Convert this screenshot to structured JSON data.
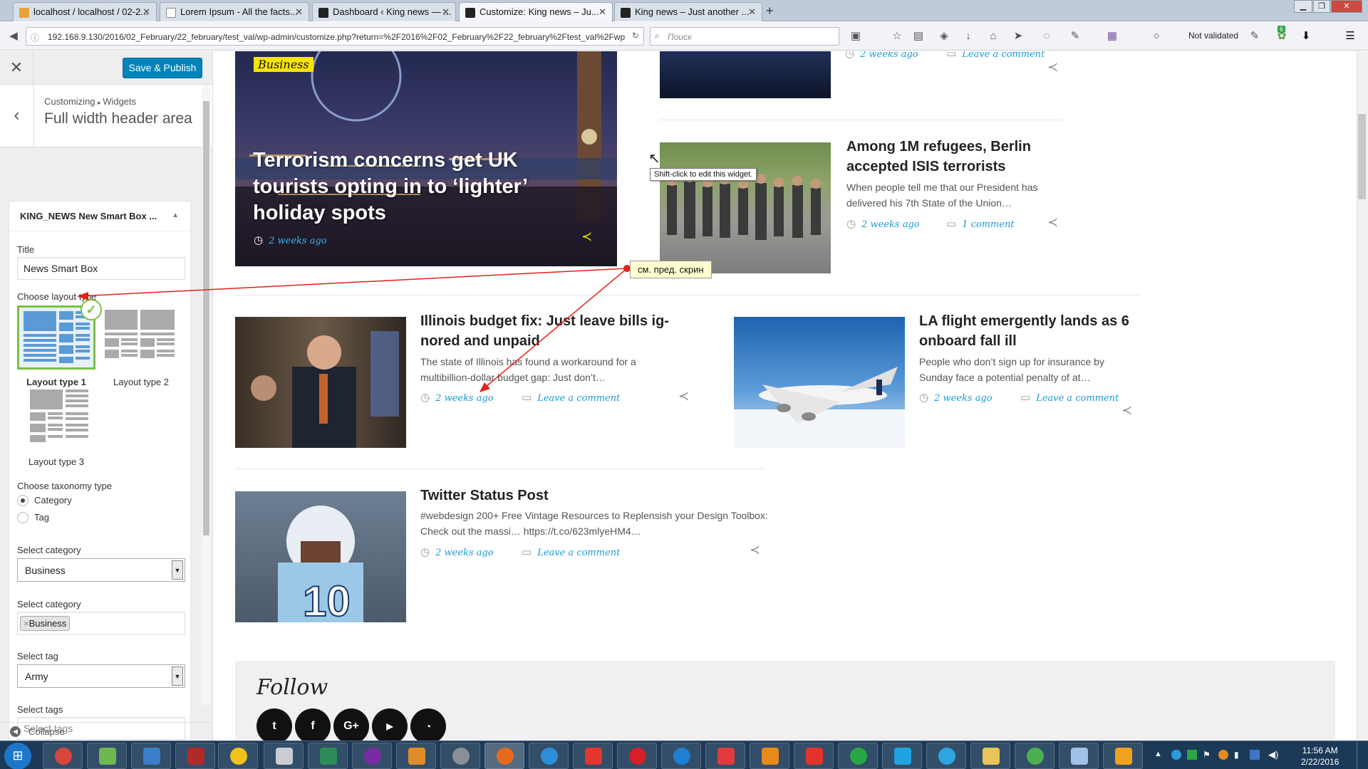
{
  "browser": {
    "tabs": [
      {
        "label": "localhost / localhost / 02-2...",
        "color": "#e8a33b"
      },
      {
        "label": "Lorem Ipsum - All the facts...",
        "color": "#ffffff"
      },
      {
        "label": "Dashboard ‹ King news — ...",
        "color": "#222222"
      },
      {
        "label": "Customize: King news – Ju...",
        "color": "#222222"
      },
      {
        "label": "King news – Just another ...",
        "color": "#222222"
      }
    ],
    "url": "192.168.9.130/2016/02_February/22_february/test_val/wp-admin/customize.php?return=%2F2016%2F02_February%2F22_february%2Ftest_val%2Fwp",
    "search_placeholder": "Поиск",
    "validation": "Not validated"
  },
  "customizer": {
    "close_icon": "close-icon",
    "save_label": "Save & Publish",
    "breadcrumb_root": "Customizing",
    "breadcrumb_leaf": "Widgets",
    "section_title": "Full width header area",
    "widget": {
      "name": "KING_NEWS New Smart Box ...",
      "title_label": "Title",
      "title_value": "News Smart Box",
      "layout_label": "Choose layout type",
      "layouts": [
        "Layout type 1",
        "Layout type 2",
        "Layout type 3"
      ],
      "taxonomy_label": "Choose taxonomy type",
      "taxonomy_options": [
        "Category",
        "Tag"
      ],
      "category_label": "Select category",
      "category_value": "Business",
      "categories_label": "Select category",
      "categories_chip": "Business",
      "tag_label": "Select tag",
      "tag_value": "Army",
      "tags_label": "Select tags",
      "tags_placeholder": "Select tags"
    },
    "collapse_label": "Collapse"
  },
  "preview": {
    "featured": {
      "badge": "Business",
      "title": "Terrorism concerns get UK tourists opting in to ‘lighter’ holiday spots",
      "date": "2 weeks ago"
    },
    "top_meta": {
      "date": "2 weeks ago",
      "comments": "Leave a comment"
    },
    "tooltip": "Shift-click to edit this widget.",
    "annotation": "см. пред. скрин",
    "posts": [
      {
        "title": "Among 1M refugees, Berlin accepted ISIS terrorists",
        "excerpt": "When people tell me that our President has delivered his 7th State of the Union…",
        "date": "2 weeks ago",
        "comments": "1 comment"
      },
      {
        "title": "Illinois budget fix: Just leave bills ig­nored and unpaid",
        "excerpt": "The state of Illinois has found a workaround for a multibillion-dollar budget gap: Just don’t…",
        "date": "2 weeks ago",
        "comments": "Leave a comment"
      },
      {
        "title": "LA flight emergently lands as 6 onboard fall ill",
        "excerpt": "People who don’t sign up for insurance by Sunday face a potential penalty of at…",
        "date": "2 weeks ago",
        "comments": "Leave a comment"
      },
      {
        "title": "Twitter Status Post",
        "excerpt": "#webdesign 200+ Free Vintage Resources to Replensish your Design Toolbox: Check out the massi… https://t.co/623mlyeHM4…",
        "date": "2 weeks ago",
        "comments": "Leave a comment"
      }
    ],
    "follow_title": "Follow",
    "social": [
      "twitter-icon",
      "facebook-icon",
      "google-plus-icon",
      "youtube-icon",
      "rss-icon"
    ]
  },
  "taskbar": {
    "time": "11:56 AM",
    "date": "2/22/2016",
    "badge_count": "6"
  }
}
